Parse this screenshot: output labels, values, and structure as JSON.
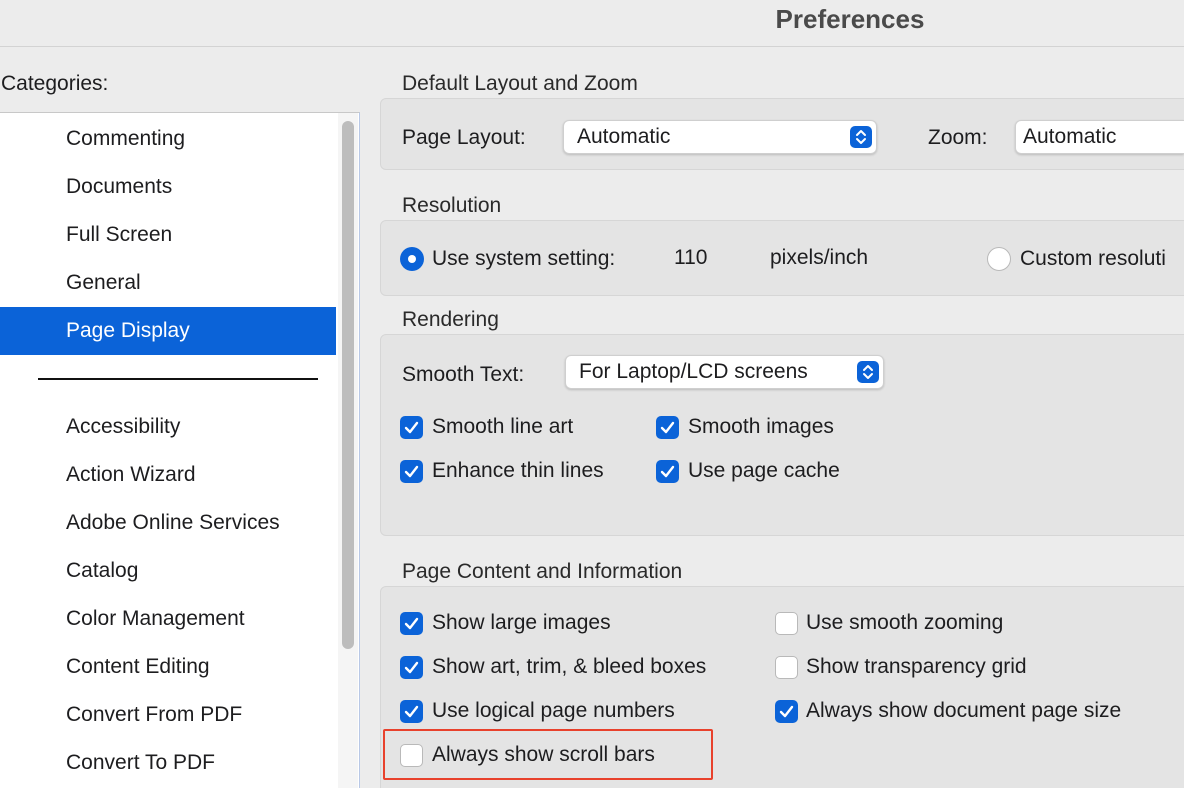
{
  "window": {
    "title": "Preferences"
  },
  "sidebar": {
    "label": "Categories:",
    "top_items": [
      "Commenting",
      "Documents",
      "Full Screen",
      "General",
      "Page Display"
    ],
    "selected": "Page Display",
    "items": [
      "Accessibility",
      "Action Wizard",
      "Adobe Online Services",
      "Catalog",
      "Color Management",
      "Content Editing",
      "Convert From PDF",
      "Convert To PDF"
    ]
  },
  "layout_zoom": {
    "title": "Default Layout and Zoom",
    "page_layout_label": "Page Layout:",
    "page_layout_value": "Automatic",
    "zoom_label": "Zoom:",
    "zoom_value": "Automatic"
  },
  "resolution": {
    "title": "Resolution",
    "system_label": "Use system setting:",
    "system_value": "110",
    "unit": "pixels/inch",
    "custom_label": "Custom resoluti",
    "selected": "system"
  },
  "rendering": {
    "title": "Rendering",
    "smooth_text_label": "Smooth Text:",
    "smooth_text_value": "For Laptop/LCD screens",
    "checkboxes": [
      {
        "label": "Smooth line art",
        "checked": true
      },
      {
        "label": "Smooth images",
        "checked": true
      },
      {
        "label": "Enhance thin lines",
        "checked": true
      },
      {
        "label": "Use page cache",
        "checked": true
      }
    ]
  },
  "page_content": {
    "title": "Page Content and Information",
    "checkboxes": [
      {
        "label": "Show large images",
        "checked": true
      },
      {
        "label": "Use smooth zooming",
        "checked": false
      },
      {
        "label": "Show art, trim, & bleed boxes",
        "checked": true
      },
      {
        "label": "Show transparency grid",
        "checked": false
      },
      {
        "label": "Use logical page numbers",
        "checked": true
      },
      {
        "label": "Always show document page size",
        "checked": true
      },
      {
        "label": "Always show scroll bars",
        "checked": false
      }
    ]
  },
  "colors": {
    "accent": "#0b63d8",
    "highlight": "#e8412c"
  }
}
